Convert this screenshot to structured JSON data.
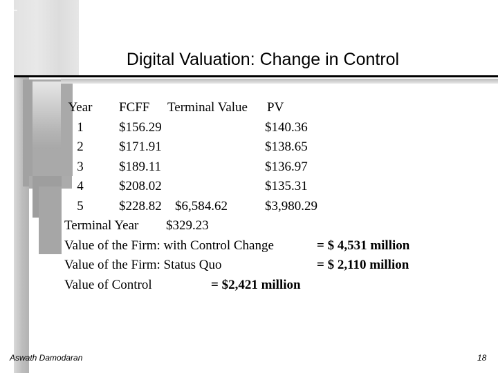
{
  "slide": {
    "title": "Digital Valuation: Change in Control",
    "page_number": "18",
    "author": "Aswath Damodaran"
  },
  "table": {
    "headers": {
      "year": "Year",
      "fcff": "FCFF",
      "terminal_value": "Terminal Value",
      "pv": "PV"
    },
    "rows": [
      {
        "year": "1",
        "fcff": "$156.29",
        "terminal_value": "",
        "pv": "$140.36"
      },
      {
        "year": "2",
        "fcff": "$171.91",
        "terminal_value": "",
        "pv": "$138.65"
      },
      {
        "year": "3",
        "fcff": "$189.11",
        "terminal_value": "",
        "pv": "$136.97"
      },
      {
        "year": "4",
        "fcff": "$208.02",
        "terminal_value": "",
        "pv": "$135.31"
      },
      {
        "year": "5",
        "fcff": "$228.82",
        "terminal_value": "$6,584.62",
        "pv": "$3,980.29"
      }
    ],
    "terminal_year": {
      "label": "Terminal Year",
      "value": "$329.23"
    }
  },
  "summary": [
    {
      "label": "Value of the Firm: with Control Change",
      "value": "= $ 4,531 million"
    },
    {
      "label": "Value of the Firm: Status Quo",
      "value": "= $ 2,110 million"
    },
    {
      "label": "Value of Control",
      "value": "= $2,421 million"
    }
  ]
}
